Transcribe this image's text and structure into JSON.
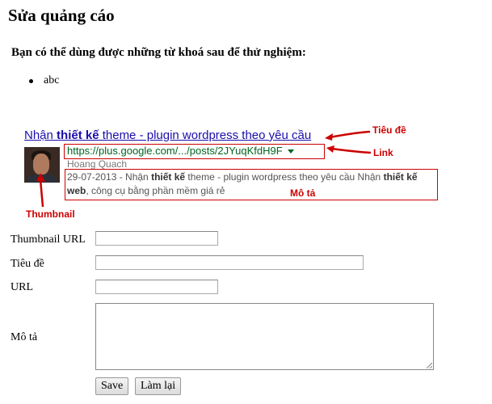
{
  "page": {
    "title": "Sửa quảng cáo",
    "hint": "Bạn có thể dùng được những từ khoá sau để thử nghiệm:",
    "keywords": [
      "abc"
    ]
  },
  "ad_preview": {
    "title_prefix": "Nhận ",
    "title_bold": "thiết kế",
    "title_suffix": " theme - plugin wordpress theo yêu cầu",
    "link": "https://plus.google.com/.../posts/2JYuqKfdH9F",
    "author": "Hoang Quach",
    "desc_part1": "29-07-2013 - Nhận ",
    "desc_bold1": "thiết kế",
    "desc_part2": " theme - plugin wordpress theo yêu cầu Nhận ",
    "desc_bold2": "thiết kế web",
    "desc_part3": ", công cụ bằng phần mềm giá rẻ"
  },
  "annotations": {
    "title": "Tiêu đề",
    "link": "Link",
    "description": "Mô tả",
    "thumbnail": "Thumbnail",
    "color": "#cc0000"
  },
  "form": {
    "thumbnail_url_label": "Thumbnail URL",
    "title_label": "Tiêu đề",
    "url_label": "URL",
    "description_label": "Mô tả",
    "thumbnail_url_value": "",
    "title_value": "",
    "url_value": "",
    "description_value": "",
    "save_label": "Save",
    "reset_label": "Làm lại"
  }
}
